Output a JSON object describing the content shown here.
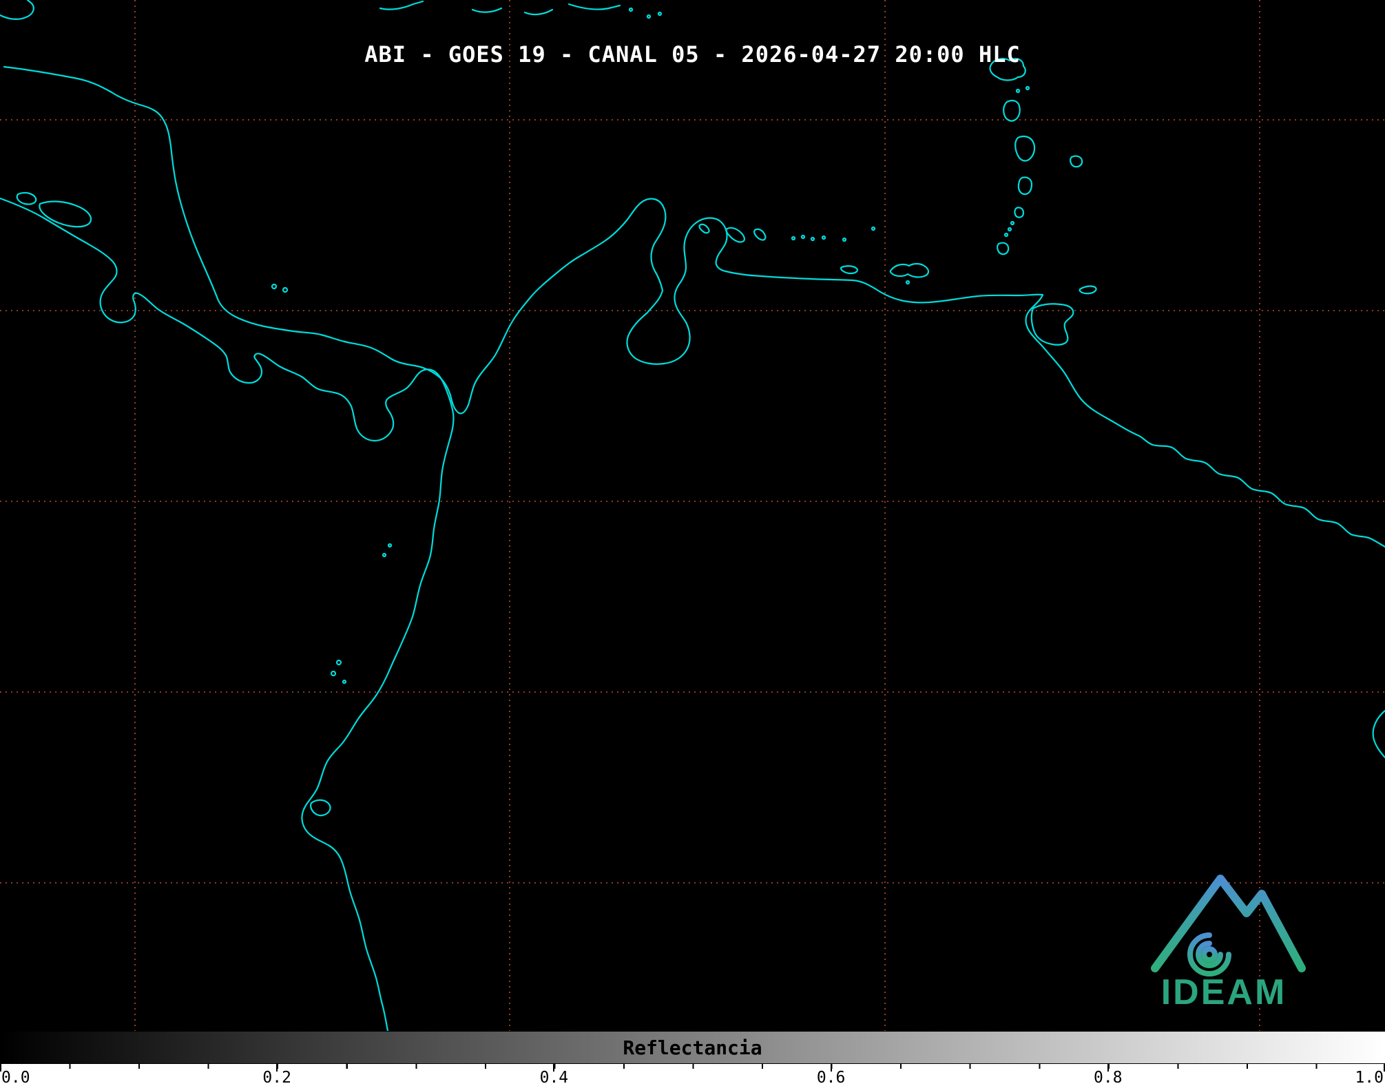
{
  "header": {
    "title": "ABI - GOES 19 - CANAL 05 - 2026-04-27 20:00 HLC"
  },
  "map": {
    "background_color": "#000000",
    "coastline_color": "#00dcdc",
    "grid_color": "#c8552a"
  },
  "colorbar": {
    "label": "Reflectancia",
    "min_value": "0.0",
    "max_value": "1.0",
    "min_color": "#000000",
    "max_color": "#ffffff",
    "ticks": [
      "0.0",
      "0.2",
      "0.4",
      "0.6",
      "0.8",
      "1.0"
    ]
  },
  "logo": {
    "text": "IDEAM",
    "color": "#2ba57f"
  }
}
